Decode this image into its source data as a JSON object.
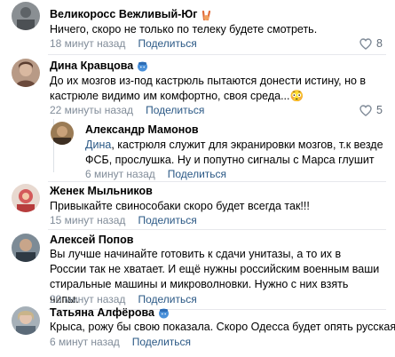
{
  "comments": [
    {
      "author": "Великоросс Вежливый-Юг",
      "text": "Ничего, скоро не только по телеку будете смотреть.",
      "time": "18 минут назад",
      "share": "Поделиться",
      "likes": "8",
      "badge_icon": "victory-hand-emoji"
    },
    {
      "author": "Дина Кравцова",
      "text": "До их мозгов из-под кастрюль пытаются донести истину, но в кастрюле видимо им комфортно, своя среда...",
      "emoji": "😳",
      "time": "22 минуты назад",
      "share": "Поделиться",
      "likes": "5",
      "badge_icon": "verified-cap-emoji"
    },
    {
      "author": "Александр Мамонов",
      "mention": "Дина",
      "text": ", кастрюля служит для экранировки мозгов, т.к везде ФСБ, прослушка. Ну и попутно сигналы с Марса глушит",
      "time": "6 минут назад",
      "share": "Поделиться"
    },
    {
      "author": "Женек Мыльников",
      "text": "Привыкайте свинособаки скоро будет всегда так!!!",
      "time": "15 минут назад",
      "share": "Поделиться"
    },
    {
      "author": "Алексей Попов",
      "text": "Вы лучше начинайте готовить к сдачи унитазы, а то их в России так не хватает. И ещё нужны российским военным ваши стиральные машины и микроволновки. Нужно с них взять чипы.",
      "time": "20 минут назад",
      "share": "Поделиться"
    },
    {
      "author": "Татьяна Алфёрова",
      "text": "Крыса, рожу бы свою показала. Скоро Одесса будет опять русская.",
      "time": "6 минут назад",
      "share": "Поделиться",
      "badge_icon": "verified-cap-emoji",
      "end_emoji_icon": "angry-face-emoji"
    }
  ],
  "colors": {
    "link": "#2a5885",
    "meta": "#818c99",
    "divider": "#e7e8ec"
  },
  "icons": {
    "like": "heart-icon"
  }
}
